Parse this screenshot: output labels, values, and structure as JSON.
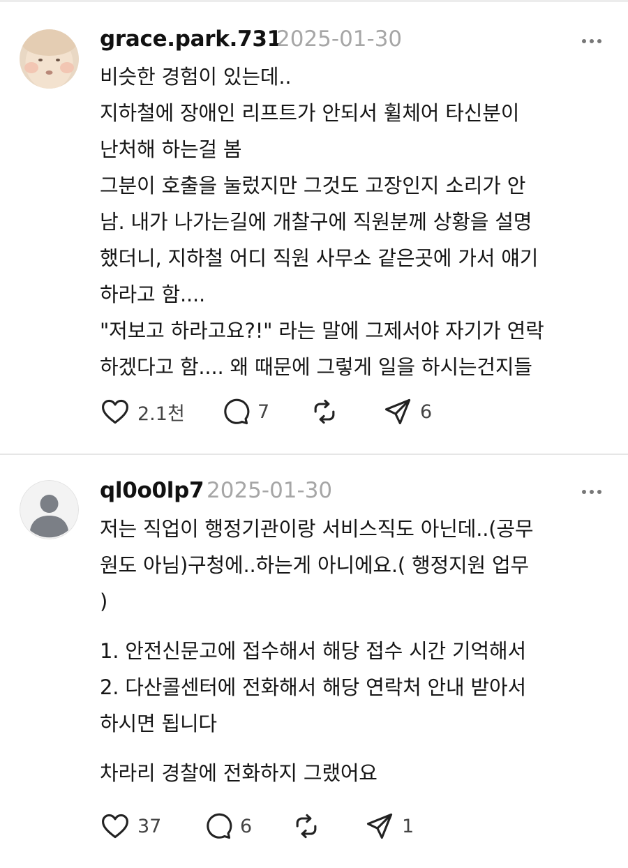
{
  "posts": [
    {
      "username": "grace.park.731",
      "date": "2025-01-30",
      "avatar_icon": "profile-photo-child",
      "paragraphs": [
        [
          "비슷한 경험이 있는데..",
          "지하철에 장애인 리프트가 안되서 휠체어 타신분이",
          "난처해 하는걸 봄",
          "그분이 호출을 눌렀지만 그것도 고장인지 소리가 안",
          "남. 내가 나가는길에 개찰구에 직원분께 상황을 설명",
          "했더니, 지하철 어디 직원 사무소 같은곳에 가서 얘기",
          "하라고 함....",
          "\"저보고 하라고요?!\" 라는 말에 그제서야 자기가 연락",
          "하겠다고 함.... 왜 때문에 그렇게 일을 하시는건지들"
        ]
      ],
      "likes": "2.1천",
      "comments": "7",
      "reposts": "",
      "shares": "6"
    },
    {
      "username": "ql0o0lp7",
      "date": "2025-01-30",
      "avatar_icon": "default-avatar-icon",
      "paragraphs": [
        [
          "저는 직업이 행정기관이랑 서비스직도 아닌데..(공무",
          "원도 아님)구청에..하는게 아니에요.( 행정지원 업무",
          ")"
        ],
        [
          "1. 안전신문고에 접수해서 해당 접수 시간 기억해서",
          "2. 다산콜센터에 전화해서 해당 연락처 안내 받아서",
          "하시면 됩니다"
        ],
        [
          "차라리 경찰에 전화하지 그랬어요"
        ]
      ],
      "likes": "37",
      "comments": "6",
      "reposts": "",
      "shares": "1"
    }
  ],
  "icons": {
    "like": "heart-icon",
    "comment": "speech-bubble-icon",
    "repost": "repost-arrows-icon",
    "share": "paper-plane-icon",
    "more": "more-dots-icon"
  },
  "colors": {
    "text": "#111111",
    "muted": "#a6a6a6",
    "icon": "#222222",
    "divider": "#e6e6e6"
  }
}
